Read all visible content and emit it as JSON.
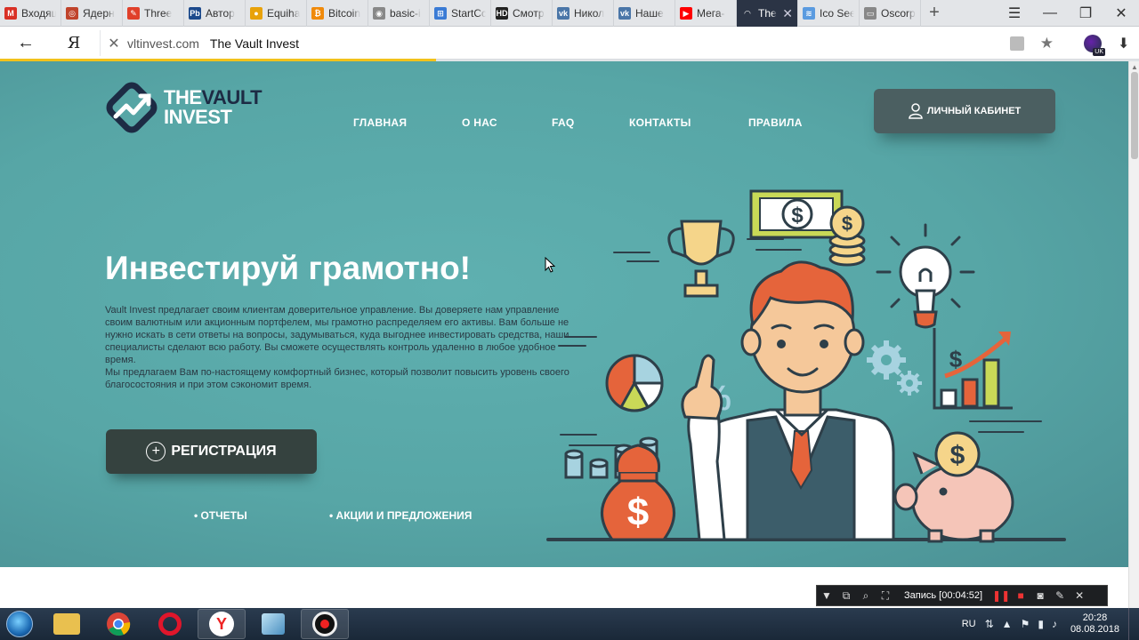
{
  "browser": {
    "tabs": [
      {
        "label": "Входящ",
        "icon": "gmail-icon",
        "color": "#d93025"
      },
      {
        "label": "Ядерн",
        "icon": "site-icon",
        "color": "#c0442c"
      },
      {
        "label": "Three",
        "icon": "three-icon",
        "color": "#e0402a"
      },
      {
        "label": "Автор",
        "icon": "pb-icon",
        "color": "#1c4a8c"
      },
      {
        "label": "Equiha",
        "icon": "coin-icon",
        "color": "#e8a20a"
      },
      {
        "label": "Bitcoin",
        "icon": "bitcoin-icon",
        "color": "#f08a0a"
      },
      {
        "label": "basic-i",
        "icon": "basic-icon",
        "color": "#888888"
      },
      {
        "label": "StartCc",
        "icon": "startcc-icon",
        "color": "#3a7bd5"
      },
      {
        "label": "Смотр",
        "icon": "hd-icon",
        "color": "#222222"
      },
      {
        "label": "Никол",
        "icon": "vk-icon",
        "color": "#4a76a8"
      },
      {
        "label": "Наше",
        "icon": "vk-icon",
        "color": "#4a76a8"
      },
      {
        "label": "Мега-",
        "icon": "youtube-icon",
        "color": "#ff0000"
      },
      {
        "label": "The",
        "icon": "loading-icon",
        "color": "#2b3445",
        "active": true
      },
      {
        "label": "Ico See",
        "icon": "ico-icon",
        "color": "#5a9be0"
      },
      {
        "label": "Oscorp",
        "icon": "doc-icon",
        "color": "#888888"
      }
    ],
    "tab_icon_text": [
      "M",
      "◎",
      "✎",
      "Pb",
      "●",
      "₿",
      "◉",
      "⊞",
      "HD",
      "vk",
      "vk",
      "▶",
      "◠",
      "≋",
      "▭"
    ],
    "new_tab": "+",
    "address": {
      "domain": "vltinvest.com",
      "title": "The Vault Invest"
    },
    "ext_badge": "UK"
  },
  "site": {
    "logo": {
      "line1_a": "THE",
      "line1_b": "VAULT",
      "line2": "INVEST"
    },
    "nav": [
      "ГЛАВНАЯ",
      "О НАС",
      "FAQ",
      "КОНТАКТЫ",
      "ПРАВИЛА"
    ],
    "cabinet_button": "ЛИЧНЫЙ КАБИНЕТ",
    "hero": {
      "title": "Инвестируй грамотно!",
      "paragraph1": "Vault Invest предлагает своим клиентам доверительное управление. Вы доверяете нам управление своим валютным или акционным портфелем, мы грамотно распределяем его активы. Вам больше не нужно искать в сети ответы на вопросы, задумываться, куда выгоднее инвестировать средства, наши специалисты сделают всю работу. Вы сможете осуществлять контроль удаленно в любое удобное время.",
      "paragraph2": "Мы предлагаем Вам по-настоящему комфортный бизнес, который позволит повысить уровень своего благосостояния и при этом сэкономит время."
    },
    "register_button": "РЕГИСТРАЦИЯ",
    "sublinks": [
      "• ОТЧЕТЫ",
      "• АКЦИИ И ПРЕДЛОЖЕНИЯ"
    ],
    "illustration": {
      "percent": "%",
      "dollar": "$"
    }
  },
  "recorder": {
    "label": "Запись [00:04:52]"
  },
  "taskbar": {
    "language": "RU",
    "time": "20:28",
    "date": "08.08.2018"
  },
  "colors": {
    "hero_bg": "#5aabab",
    "dark_button": "#35423f",
    "loading_bar": "#f2c21b",
    "tie_orange": "#e5643b"
  }
}
